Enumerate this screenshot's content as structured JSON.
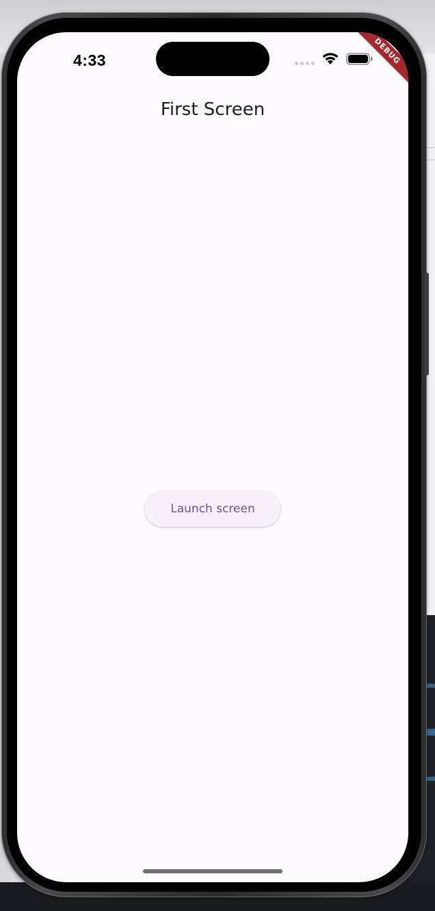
{
  "status_bar": {
    "time": "4:33",
    "icons": [
      "signal-dots-icon",
      "wifi-icon",
      "battery-icon"
    ]
  },
  "debug_banner": {
    "label": "DEBUG",
    "color": "#a4282d"
  },
  "app_bar": {
    "title": "First Screen"
  },
  "main": {
    "launch_button_label": "Launch screen"
  },
  "colors": {
    "screen_background": "#fdfbfe",
    "button_background": "#f7f2fa",
    "button_text": "#6750a4",
    "title_text": "#1c1b1f"
  }
}
